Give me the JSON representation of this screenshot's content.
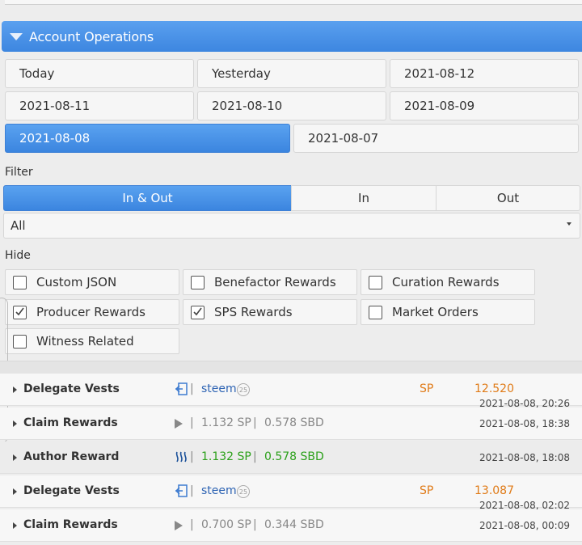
{
  "header": {
    "title": "Account Operations"
  },
  "dates": {
    "today": "Today",
    "yesterday": "Yesterday",
    "d0812": "2021-08-12",
    "d0811": "2021-08-11",
    "d0810": "2021-08-10",
    "d0809": "2021-08-09",
    "d0808": "2021-08-08",
    "d0807": "2021-08-07",
    "selected": "2021-08-08"
  },
  "filter": {
    "label": "Filter",
    "options": [
      "In & Out",
      "In",
      "Out"
    ],
    "selected": "In & Out",
    "type_value": "All"
  },
  "hide": {
    "label": "Hide",
    "items": [
      {
        "label": "Custom JSON",
        "checked": false
      },
      {
        "label": "Benefactor Rewards",
        "checked": false
      },
      {
        "label": "Curation Rewards",
        "checked": false
      },
      {
        "label": "Producer Rewards",
        "checked": true
      },
      {
        "label": "SPS Rewards",
        "checked": true
      },
      {
        "label": "Market Orders",
        "checked": false
      },
      {
        "label": "Witness Related",
        "checked": false
      }
    ]
  },
  "operations": [
    {
      "type": "Delegate Vests",
      "account": "steem",
      "rep": "25",
      "unit": "SP",
      "amount": "12.520",
      "time": "2021-08-08, 20:26"
    },
    {
      "type": "Claim Rewards",
      "sp": "1.132 SP",
      "sbd": "0.578 SBD",
      "time": "2021-08-08, 18:38"
    },
    {
      "type": "Author Reward",
      "sp": "1.132 SP",
      "sbd": "0.578 SBD",
      "time": "2021-08-08, 18:08"
    },
    {
      "type": "Delegate Vests",
      "account": "steem",
      "rep": "25",
      "unit": "SP",
      "amount": "13.087",
      "time": "2021-08-08, 02:02"
    },
    {
      "type": "Claim Rewards",
      "sp": "0.700 SP",
      "sbd": "0.344 SBD",
      "time": "2021-08-08, 00:09"
    }
  ],
  "separator": "|",
  "colors": {
    "accent": "#3d86e0",
    "sp_orange": "#e07b18",
    "link_blue": "#2d63b3",
    "green": "#2ba01a"
  }
}
